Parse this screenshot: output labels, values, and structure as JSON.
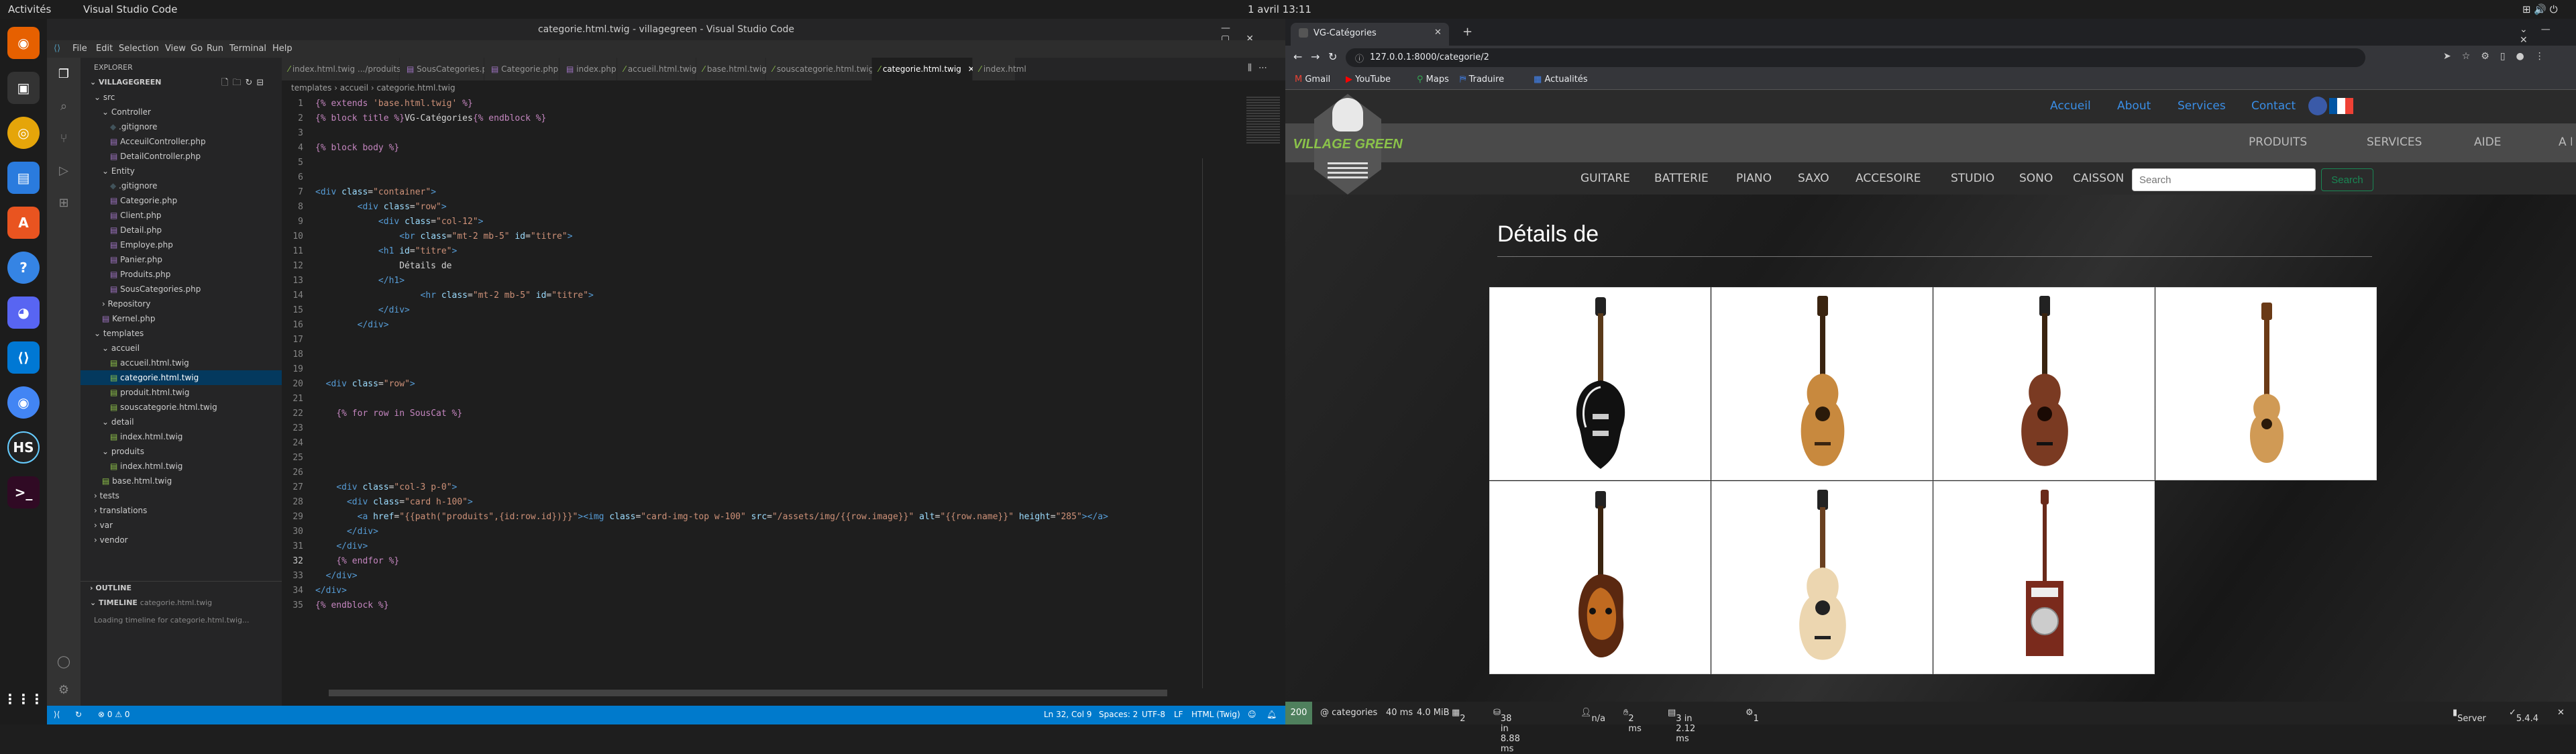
{
  "topbar": {
    "activities": "Activités",
    "app": "Visual Studio Code",
    "clock": "1 avril  13:11"
  },
  "vscode": {
    "title": "categorie.html.twig - villagegreen - Visual Studio Code",
    "menu": [
      "File",
      "Edit",
      "Selection",
      "View",
      "Go",
      "Run",
      "Terminal",
      "Help"
    ],
    "explorer_header": "EXPLORER",
    "project": "VILLAGEGREEN",
    "tree": [
      {
        "label": "src",
        "indent": 1,
        "kind": "folder-open"
      },
      {
        "label": "Controller",
        "indent": 2,
        "kind": "folder-open"
      },
      {
        "label": ".gitignore",
        "indent": 3,
        "kind": "file"
      },
      {
        "label": "AcceuilController.php",
        "indent": 3,
        "kind": "php"
      },
      {
        "label": "DetailController.php",
        "indent": 3,
        "kind": "php"
      },
      {
        "label": "Entity",
        "indent": 2,
        "kind": "folder-open"
      },
      {
        "label": ".gitignore",
        "indent": 3,
        "kind": "file"
      },
      {
        "label": "Categorie.php",
        "indent": 3,
        "kind": "php"
      },
      {
        "label": "Client.php",
        "indent": 3,
        "kind": "php"
      },
      {
        "label": "Detail.php",
        "indent": 3,
        "kind": "php"
      },
      {
        "label": "Employe.php",
        "indent": 3,
        "kind": "php"
      },
      {
        "label": "Panier.php",
        "indent": 3,
        "kind": "php"
      },
      {
        "label": "Produits.php",
        "indent": 3,
        "kind": "php"
      },
      {
        "label": "SousCategories.php",
        "indent": 3,
        "kind": "php"
      },
      {
        "label": "Repository",
        "indent": 2,
        "kind": "folder"
      },
      {
        "label": "Kernel.php",
        "indent": 2,
        "kind": "php"
      },
      {
        "label": "templates",
        "indent": 1,
        "kind": "folder-open"
      },
      {
        "label": "accueil",
        "indent": 2,
        "kind": "folder-open"
      },
      {
        "label": "accueil.html.twig",
        "indent": 3,
        "kind": "twig"
      },
      {
        "label": "categorie.html.twig",
        "indent": 3,
        "kind": "twig",
        "selected": true
      },
      {
        "label": "produit.html.twig",
        "indent": 3,
        "kind": "twig"
      },
      {
        "label": "souscategorie.html.twig",
        "indent": 3,
        "kind": "twig"
      },
      {
        "label": "detail",
        "indent": 2,
        "kind": "folder-open"
      },
      {
        "label": "index.html.twig",
        "indent": 3,
        "kind": "twig"
      },
      {
        "label": "produits",
        "indent": 2,
        "kind": "folder-open"
      },
      {
        "label": "index.html.twig",
        "indent": 3,
        "kind": "twig"
      },
      {
        "label": "base.html.twig",
        "indent": 2,
        "kind": "twig"
      },
      {
        "label": "tests",
        "indent": 1,
        "kind": "folder"
      },
      {
        "label": "translations",
        "indent": 1,
        "kind": "folder"
      },
      {
        "label": "var",
        "indent": 1,
        "kind": "folder"
      },
      {
        "label": "vendor",
        "indent": 1,
        "kind": "folder"
      }
    ],
    "outline_label": "OUTLINE",
    "timeline_label": "TIMELINE",
    "timeline_file": "categorie.html.twig",
    "timeline_loading": "Loading timeline for categorie.html.twig...",
    "tabs": [
      "index.html.twig .../produits",
      "SousCategories.php",
      "Categorie.php",
      "index.php",
      "accueil.html.twig",
      "base.html.twig",
      "souscategorie.html.twig",
      "categorie.html.twig",
      "index.html"
    ],
    "active_tab": "categorie.html.twig",
    "breadcrumb": "templates  ›  accueil  ›  categorie.html.twig",
    "code": [
      [
        {
          "c": "t-tw",
          "t": "{% extends "
        },
        {
          "c": "t-str",
          "t": "'base.html.twig'"
        },
        {
          "c": "t-tw",
          "t": " %}"
        }
      ],
      [
        {
          "c": "t-tw",
          "t": "{% block title %}"
        },
        {
          "c": "t-txt",
          "t": "VG-Catégories"
        },
        {
          "c": "t-tw",
          "t": "{% endblock %}"
        }
      ],
      [],
      [
        {
          "c": "t-tw",
          "t": "{% block body %}"
        }
      ],
      [],
      [],
      [
        {
          "c": "t-tag",
          "t": "<div "
        },
        {
          "c": "t-attr",
          "t": "class"
        },
        {
          "c": "t-txt",
          "t": "="
        },
        {
          "c": "t-str",
          "t": "\"container\""
        },
        {
          "c": "t-tag",
          "t": ">"
        }
      ],
      [
        {
          "c": "t-txt",
          "t": "        "
        },
        {
          "c": "t-tag",
          "t": "<div "
        },
        {
          "c": "t-attr",
          "t": "class"
        },
        {
          "c": "t-txt",
          "t": "="
        },
        {
          "c": "t-str",
          "t": "\"row\""
        },
        {
          "c": "t-tag",
          "t": ">"
        }
      ],
      [
        {
          "c": "t-txt",
          "t": "            "
        },
        {
          "c": "t-tag",
          "t": "<div "
        },
        {
          "c": "t-attr",
          "t": "class"
        },
        {
          "c": "t-txt",
          "t": "="
        },
        {
          "c": "t-str",
          "t": "\"col-12\""
        },
        {
          "c": "t-tag",
          "t": ">"
        }
      ],
      [
        {
          "c": "t-txt",
          "t": "                "
        },
        {
          "c": "t-tag",
          "t": "<br "
        },
        {
          "c": "t-attr",
          "t": "class"
        },
        {
          "c": "t-txt",
          "t": "="
        },
        {
          "c": "t-str",
          "t": "\"mt-2 mb-5\""
        },
        {
          "c": "t-attr",
          "t": " id"
        },
        {
          "c": "t-txt",
          "t": "="
        },
        {
          "c": "t-str",
          "t": "\"titre\""
        },
        {
          "c": "t-tag",
          "t": ">"
        }
      ],
      [
        {
          "c": "t-txt",
          "t": "            "
        },
        {
          "c": "t-tag",
          "t": "<h1 "
        },
        {
          "c": "t-attr",
          "t": "id"
        },
        {
          "c": "t-txt",
          "t": "="
        },
        {
          "c": "t-str",
          "t": "\"titre\""
        },
        {
          "c": "t-tag",
          "t": ">"
        }
      ],
      [
        {
          "c": "t-txt",
          "t": "                Détails de"
        }
      ],
      [
        {
          "c": "t-txt",
          "t": "            "
        },
        {
          "c": "t-tag",
          "t": "</h1>"
        }
      ],
      [
        {
          "c": "t-txt",
          "t": "                    "
        },
        {
          "c": "t-tag",
          "t": "<hr "
        },
        {
          "c": "t-attr",
          "t": "class"
        },
        {
          "c": "t-txt",
          "t": "="
        },
        {
          "c": "t-str",
          "t": "\"mt-2 mb-5\""
        },
        {
          "c": "t-attr",
          "t": " id"
        },
        {
          "c": "t-txt",
          "t": "="
        },
        {
          "c": "t-str",
          "t": "\"titre\""
        },
        {
          "c": "t-tag",
          "t": ">"
        }
      ],
      [
        {
          "c": "t-txt",
          "t": "            "
        },
        {
          "c": "t-tag",
          "t": "</div>"
        }
      ],
      [
        {
          "c": "t-txt",
          "t": "        "
        },
        {
          "c": "t-tag",
          "t": "</div>"
        }
      ],
      [],
      [],
      [],
      [
        {
          "c": "t-txt",
          "t": "  "
        },
        {
          "c": "t-tag",
          "t": "<div "
        },
        {
          "c": "t-attr",
          "t": "class"
        },
        {
          "c": "t-txt",
          "t": "="
        },
        {
          "c": "t-str",
          "t": "\"row\""
        },
        {
          "c": "t-tag",
          "t": ">"
        }
      ],
      [],
      [
        {
          "c": "t-txt",
          "t": "    "
        },
        {
          "c": "t-tw",
          "t": "{% for row in SousCat %}"
        }
      ],
      [],
      [],
      [],
      [],
      [
        {
          "c": "t-txt",
          "t": "    "
        },
        {
          "c": "t-tag",
          "t": "<div "
        },
        {
          "c": "t-attr",
          "t": "class"
        },
        {
          "c": "t-txt",
          "t": "="
        },
        {
          "c": "t-str",
          "t": "\"col-3 p-0\""
        },
        {
          "c": "t-tag",
          "t": ">"
        }
      ],
      [
        {
          "c": "t-txt",
          "t": "      "
        },
        {
          "c": "t-tag",
          "t": "<div "
        },
        {
          "c": "t-attr",
          "t": "class"
        },
        {
          "c": "t-txt",
          "t": "="
        },
        {
          "c": "t-str",
          "t": "\"card h-100\""
        },
        {
          "c": "t-tag",
          "t": ">"
        }
      ],
      [
        {
          "c": "t-txt",
          "t": "        "
        },
        {
          "c": "t-tag",
          "t": "<a "
        },
        {
          "c": "t-attr",
          "t": "href"
        },
        {
          "c": "t-txt",
          "t": "="
        },
        {
          "c": "t-str",
          "t": "\"{{path(\"produits\",{id:row.id})}}\""
        },
        {
          "c": "t-tag",
          "t": ">"
        },
        {
          "c": "t-tag",
          "t": "<img "
        },
        {
          "c": "t-attr",
          "t": "class"
        },
        {
          "c": "t-txt",
          "t": "="
        },
        {
          "c": "t-str",
          "t": "\"card-img-top w-100\""
        },
        {
          "c": "t-attr",
          "t": " src"
        },
        {
          "c": "t-txt",
          "t": "="
        },
        {
          "c": "t-str",
          "t": "\"/assets/img/{{row.image}}\""
        },
        {
          "c": "t-attr",
          "t": " alt"
        },
        {
          "c": "t-txt",
          "t": "="
        },
        {
          "c": "t-str",
          "t": "\"{{row.name}}\""
        },
        {
          "c": "t-attr",
          "t": " height"
        },
        {
          "c": "t-txt",
          "t": "="
        },
        {
          "c": "t-str",
          "t": "\"285\""
        },
        {
          "c": "t-tag",
          "t": "></a>"
        }
      ],
      [
        {
          "c": "t-txt",
          "t": "      "
        },
        {
          "c": "t-tag",
          "t": "</div>"
        }
      ],
      [
        {
          "c": "t-txt",
          "t": "    "
        },
        {
          "c": "t-tag",
          "t": "</div>"
        }
      ],
      [
        {
          "c": "t-txt",
          "t": "    "
        },
        {
          "c": "t-tw",
          "t": "{% endfor %}"
        }
      ],
      [
        {
          "c": "t-txt",
          "t": "  "
        },
        {
          "c": "t-tag",
          "t": "</div>"
        }
      ],
      [
        {
          "c": "t-tag",
          "t": "</div>"
        }
      ],
      [
        {
          "c": "t-tw",
          "t": "{% endblock %}"
        }
      ]
    ],
    "status": {
      "position": "Ln 32, Col 9",
      "spaces": "Spaces: 2",
      "encoding": "UTF-8",
      "eol": "LF",
      "language": "HTML (Twig)",
      "problems": "⊗ 0 ⚠ 0"
    }
  },
  "browser": {
    "tab_title": "VG-Catégories",
    "url": "127.0.0.1:8000/categorie/2",
    "bookmarks": [
      "Gmail",
      "YouTube",
      "Maps",
      "Traduire",
      "Actualités"
    ],
    "site": {
      "logo": "VILLAGE GREEN",
      "top_links": [
        "Accueil",
        "About",
        "Services",
        "Contact"
      ],
      "mid_links": [
        "PRODUITS",
        "SERVICES",
        "AIDE",
        "A PROPOS"
      ],
      "cat_links": [
        "GUITARE",
        "BATTERIE",
        "PIANO",
        "SAXO",
        "ACCESOIRE",
        "STUDIO",
        "SONO",
        "CAISSON"
      ],
      "search_placeholder": "Search",
      "search_button": "Search",
      "heading": "Détails de",
      "products": [
        "les-paul",
        "classical",
        "acoustic-dark",
        "ukulele",
        "mandolin",
        "acoustic-light",
        "resonator"
      ]
    },
    "profiler": {
      "status": "200",
      "route": "@ categories",
      "time": "40 ms",
      "memory": "4.0 MiB",
      "a": "2",
      "b": "38 in 8.88 ms",
      "c": "n/a",
      "d": "2 ms",
      "e": "3 in 2.12 ms",
      "f": "1",
      "server": "Server",
      "version": "5.4.4"
    }
  }
}
